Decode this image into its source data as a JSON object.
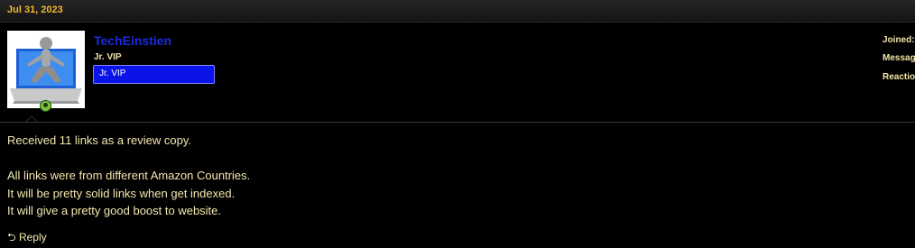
{
  "post": {
    "date": "Jul 31, 2023",
    "author": {
      "username": "TechEinstien",
      "user_title": "Jr. VIP",
      "banner": "Jr. VIP",
      "avatar_icon": "person-on-laptop-icon",
      "status_icon": "online-status-icon"
    },
    "stats": {
      "joined_label": "Joined:",
      "messages_label": "Messag",
      "reactions_label": "Reactio"
    },
    "body": {
      "line1": "Received 11 links as a review copy.",
      "line2": "All links were from different Amazon Countries.",
      "line3": "It will be pretty solid links when get indexed.",
      "line4": "It will give a pretty good boost to website."
    },
    "reply_label": "Reply"
  },
  "colors": {
    "background": "#000000",
    "date": "#f0b830",
    "username": "#1a2be0",
    "text": "#f3e7ae",
    "banner_bg": "#0a14e8",
    "online": "#7cc23a"
  }
}
